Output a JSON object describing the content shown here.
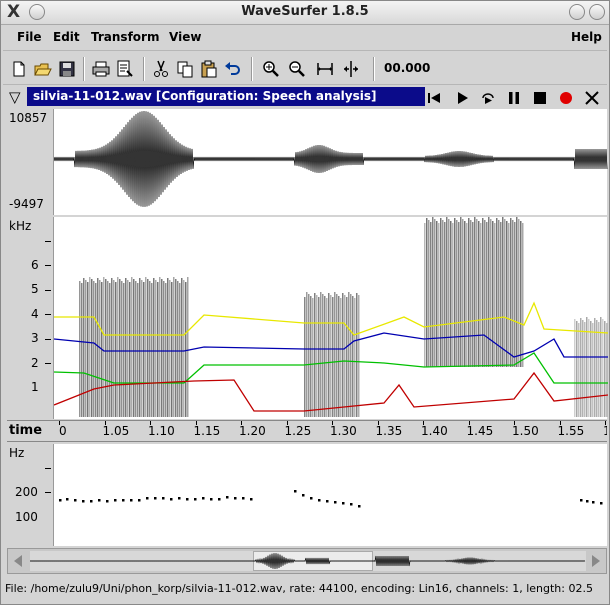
{
  "window": {
    "title": "WaveSurfer 1.8.5",
    "left_buttons": [
      "close-x-icon",
      "circle-button-icon"
    ],
    "right_buttons": [
      "circle-button-icon",
      "circle-button-icon"
    ]
  },
  "menu": {
    "file": "File",
    "edit": "Edit",
    "transform": "Transform",
    "view": "View",
    "help": "Help"
  },
  "toolbar": {
    "icons": [
      "new-file-icon",
      "open-folder-icon",
      "save-icon",
      "print-icon",
      "properties-icon",
      "cut-icon",
      "copy-icon",
      "paste-icon",
      "undo-icon",
      "zoom-in-icon",
      "zoom-out-icon",
      "zoom-selection-icon",
      "zoom-all-icon"
    ],
    "time": "00.000"
  },
  "sound": {
    "title": "silvia-11-012.wav  [Configuration: Speech analysis]",
    "controls": [
      "skip-to-start-icon",
      "play-icon",
      "play-loop-icon",
      "pause-icon",
      "stop-icon",
      "record-icon",
      "close-icon"
    ],
    "record_color": "#e00000"
  },
  "waveform": {
    "max_label": "10857",
    "min_label": "-9497"
  },
  "spectrogram": {
    "unit_label": "kHz",
    "ticks": [
      "6",
      "5",
      "4",
      "3",
      "2",
      "1"
    ],
    "formant_colors": [
      "#e8e800",
      "#0000b0",
      "#00c000",
      "#c00000"
    ]
  },
  "time_axis": {
    "label": "time",
    "ticks": [
      "0",
      "1.05",
      "1.10",
      "1.15",
      "1.20",
      "1.25",
      "1.30",
      "1.35",
      "1.40",
      "1.45",
      "1.50",
      "1.55",
      "1"
    ]
  },
  "pitch": {
    "unit_label": "Hz",
    "ticks": [
      "200",
      "100"
    ]
  },
  "status": {
    "text": "File: /home/zulu9/Uni/phon_korp/silvia-11-012.wav, rate: 44100, encoding: Lin16, channels: 1, length: 02.5"
  }
}
